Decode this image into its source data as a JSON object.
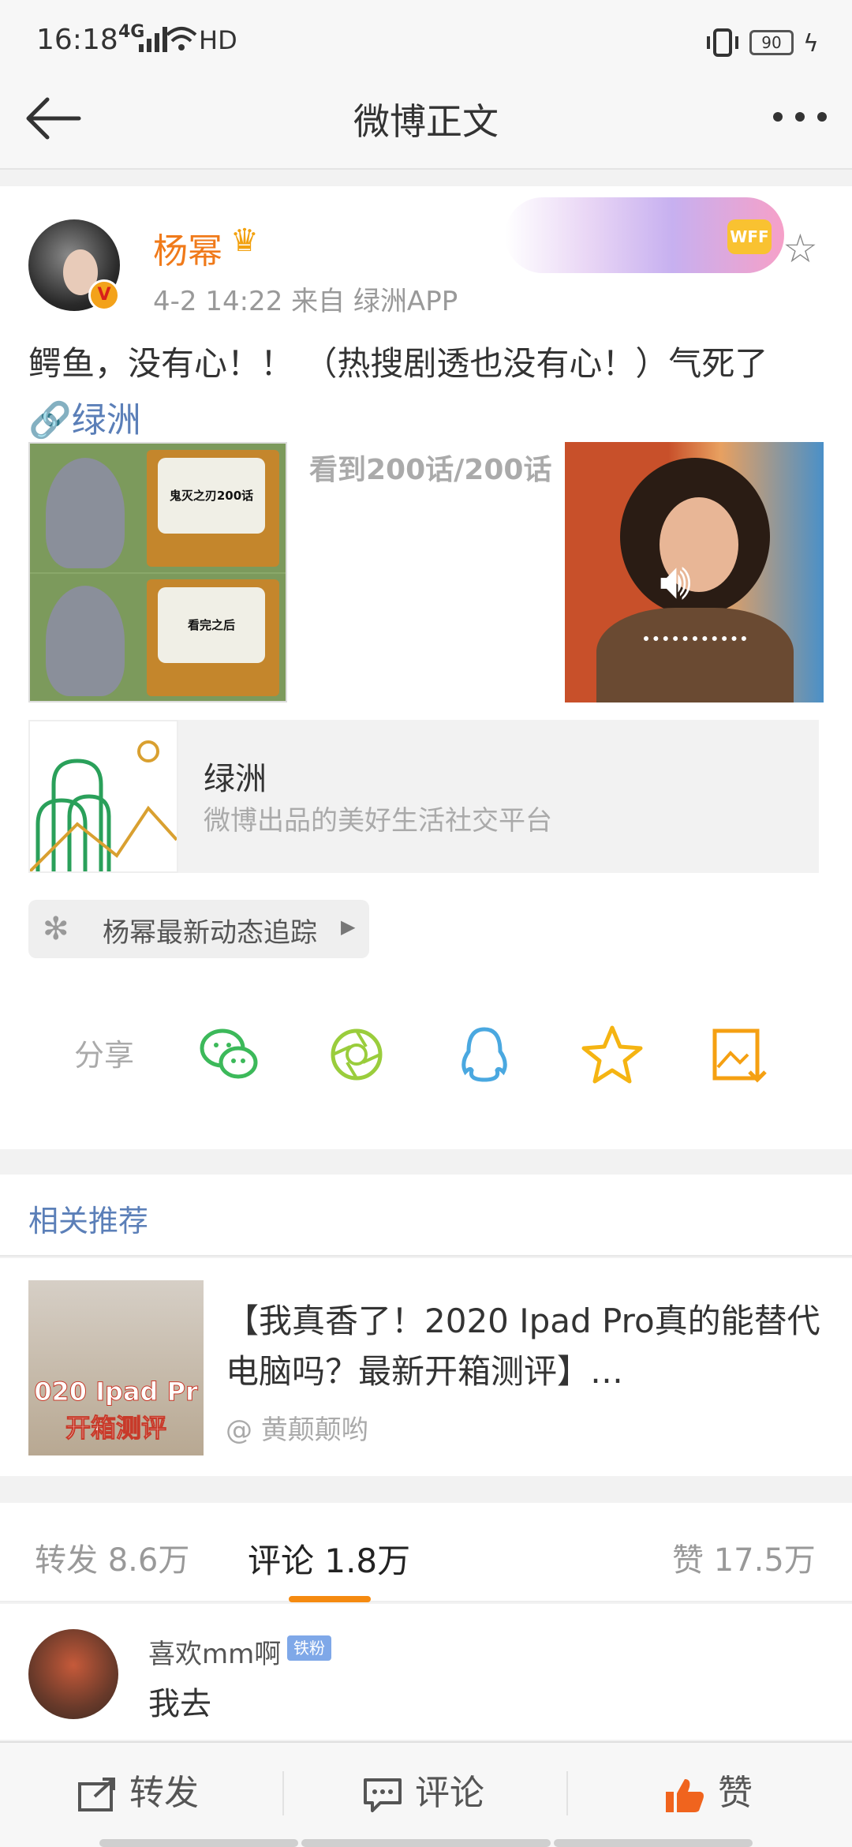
{
  "status_bar": {
    "time": "16:18",
    "network": "4G",
    "hd": "HD",
    "battery": "90"
  },
  "nav": {
    "title": "微博正文"
  },
  "post": {
    "username": "杨幂",
    "meta": "4-2 14:22  来自 绿洲APP",
    "banner_badge": "WFF",
    "content": "鳄鱼，没有心！！ （热搜剧透也没有心！）气死了",
    "link_text": "绿洲",
    "image1_top_text": "鬼灭之刃200话",
    "image1_bottom_text": "看完之后",
    "image2_text": "看到200话/200话",
    "link_card": {
      "title": "绿洲",
      "subtitle": "微博出品的美好生活社交平台"
    },
    "tracker": "杨幂最新动态追踪",
    "share_label": "分享"
  },
  "related": {
    "title": "相关推荐",
    "item_text": "【我真香了！2020 Ipad Pro真的能替代电脑吗？最新开箱测评】…",
    "item_author": "@ 黄颠颠哟",
    "thumb_text_line1": "020 Ipad Pr",
    "thumb_text_line2": "开箱测评"
  },
  "stats": {
    "repost": "转发 8.6万",
    "comment": "评论 1.8万",
    "like": "赞 17.5万"
  },
  "comment": {
    "user": "喜欢mm啊",
    "badge": "铁粉",
    "text": "我去"
  },
  "bottom_bar": {
    "repost": "转发",
    "comment": "评论",
    "like": "赞"
  },
  "colors": {
    "accent_orange": "#f58a10",
    "link_blue": "#5b7fb8",
    "username_orange": "#f07a1a"
  }
}
